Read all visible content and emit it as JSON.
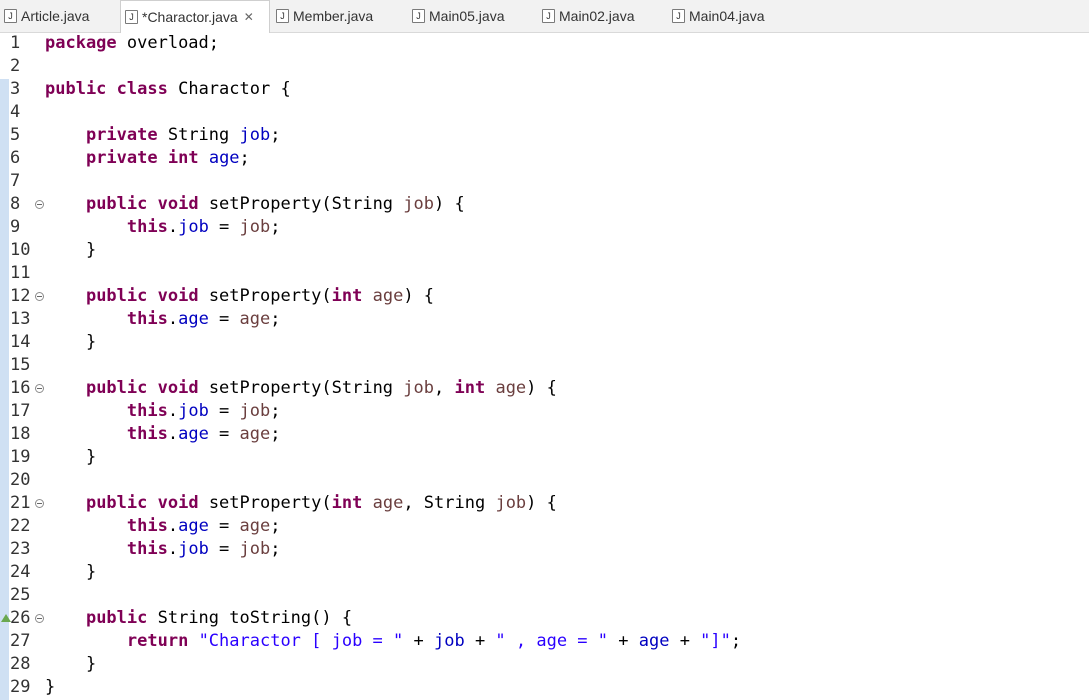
{
  "tabs": [
    {
      "label": "Article.java",
      "active": false,
      "closable": false
    },
    {
      "label": "*Charactor.java",
      "active": true,
      "closable": true
    },
    {
      "label": "Member.java",
      "active": false,
      "closable": false
    },
    {
      "label": "Main05.java",
      "active": false,
      "closable": false
    },
    {
      "label": "Main02.java",
      "active": false,
      "closable": false
    },
    {
      "label": "Main04.java",
      "active": false,
      "closable": false
    }
  ],
  "tab_icon_glyph": "J",
  "tab_close_glyph": "✕",
  "colors": {
    "keyword": "#7f0055",
    "field": "#0000c0",
    "parameter": "#6a3e3e",
    "string": "#2a00ff",
    "plain": "#000000",
    "ruler_highlight": "#cfe0f3"
  },
  "editor": {
    "lines": [
      {
        "n": "1",
        "fold": false,
        "warn": false,
        "tokens": [
          {
            "t": "kw",
            "v": "package"
          },
          {
            "t": "pl",
            "v": " overload;"
          }
        ]
      },
      {
        "n": "2",
        "fold": false,
        "warn": false,
        "tokens": []
      },
      {
        "n": "3",
        "fold": false,
        "warn": false,
        "tokens": [
          {
            "t": "kw",
            "v": "public"
          },
          {
            "t": "pl",
            "v": " "
          },
          {
            "t": "kw",
            "v": "class"
          },
          {
            "t": "pl",
            "v": " Charactor {"
          }
        ]
      },
      {
        "n": "4",
        "fold": false,
        "warn": false,
        "tokens": []
      },
      {
        "n": "5",
        "fold": false,
        "warn": false,
        "tokens": [
          {
            "t": "pl",
            "v": "    "
          },
          {
            "t": "kw",
            "v": "private"
          },
          {
            "t": "pl",
            "v": " String "
          },
          {
            "t": "fd",
            "v": "job"
          },
          {
            "t": "pl",
            "v": ";"
          }
        ]
      },
      {
        "n": "6",
        "fold": false,
        "warn": false,
        "tokens": [
          {
            "t": "pl",
            "v": "    "
          },
          {
            "t": "kw",
            "v": "private"
          },
          {
            "t": "pl",
            "v": " "
          },
          {
            "t": "kw",
            "v": "int"
          },
          {
            "t": "pl",
            "v": " "
          },
          {
            "t": "fd",
            "v": "age"
          },
          {
            "t": "pl",
            "v": ";"
          }
        ]
      },
      {
        "n": "7",
        "fold": false,
        "warn": false,
        "tokens": []
      },
      {
        "n": "8",
        "fold": true,
        "warn": false,
        "tokens": [
          {
            "t": "pl",
            "v": "    "
          },
          {
            "t": "kw",
            "v": "public"
          },
          {
            "t": "pl",
            "v": " "
          },
          {
            "t": "kw",
            "v": "void"
          },
          {
            "t": "pl",
            "v": " setProperty(String "
          },
          {
            "t": "pr",
            "v": "job"
          },
          {
            "t": "pl",
            "v": ") {"
          }
        ]
      },
      {
        "n": "9",
        "fold": false,
        "warn": false,
        "tokens": [
          {
            "t": "pl",
            "v": "        "
          },
          {
            "t": "kw",
            "v": "this"
          },
          {
            "t": "pl",
            "v": "."
          },
          {
            "t": "fd",
            "v": "job"
          },
          {
            "t": "pl",
            "v": " = "
          },
          {
            "t": "pr",
            "v": "job"
          },
          {
            "t": "pl",
            "v": ";"
          }
        ]
      },
      {
        "n": "10",
        "fold": false,
        "warn": false,
        "tokens": [
          {
            "t": "pl",
            "v": "    }"
          }
        ]
      },
      {
        "n": "11",
        "fold": false,
        "warn": false,
        "tokens": []
      },
      {
        "n": "12",
        "fold": true,
        "warn": false,
        "tokens": [
          {
            "t": "pl",
            "v": "    "
          },
          {
            "t": "kw",
            "v": "public"
          },
          {
            "t": "pl",
            "v": " "
          },
          {
            "t": "kw",
            "v": "void"
          },
          {
            "t": "pl",
            "v": " setProperty("
          },
          {
            "t": "kw",
            "v": "int"
          },
          {
            "t": "pl",
            "v": " "
          },
          {
            "t": "pr",
            "v": "age"
          },
          {
            "t": "pl",
            "v": ") {"
          }
        ]
      },
      {
        "n": "13",
        "fold": false,
        "warn": false,
        "tokens": [
          {
            "t": "pl",
            "v": "        "
          },
          {
            "t": "kw",
            "v": "this"
          },
          {
            "t": "pl",
            "v": "."
          },
          {
            "t": "fd",
            "v": "age"
          },
          {
            "t": "pl",
            "v": " = "
          },
          {
            "t": "pr",
            "v": "age"
          },
          {
            "t": "pl",
            "v": ";"
          }
        ]
      },
      {
        "n": "14",
        "fold": false,
        "warn": false,
        "tokens": [
          {
            "t": "pl",
            "v": "    }"
          }
        ]
      },
      {
        "n": "15",
        "fold": false,
        "warn": false,
        "tokens": []
      },
      {
        "n": "16",
        "fold": true,
        "warn": false,
        "tokens": [
          {
            "t": "pl",
            "v": "    "
          },
          {
            "t": "kw",
            "v": "public"
          },
          {
            "t": "pl",
            "v": " "
          },
          {
            "t": "kw",
            "v": "void"
          },
          {
            "t": "pl",
            "v": " setProperty(String "
          },
          {
            "t": "pr",
            "v": "job"
          },
          {
            "t": "pl",
            "v": ", "
          },
          {
            "t": "kw",
            "v": "int"
          },
          {
            "t": "pl",
            "v": " "
          },
          {
            "t": "pr",
            "v": "age"
          },
          {
            "t": "pl",
            "v": ") {"
          }
        ]
      },
      {
        "n": "17",
        "fold": false,
        "warn": false,
        "tokens": [
          {
            "t": "pl",
            "v": "        "
          },
          {
            "t": "kw",
            "v": "this"
          },
          {
            "t": "pl",
            "v": "."
          },
          {
            "t": "fd",
            "v": "job"
          },
          {
            "t": "pl",
            "v": " = "
          },
          {
            "t": "pr",
            "v": "job"
          },
          {
            "t": "pl",
            "v": ";"
          }
        ]
      },
      {
        "n": "18",
        "fold": false,
        "warn": false,
        "tokens": [
          {
            "t": "pl",
            "v": "        "
          },
          {
            "t": "kw",
            "v": "this"
          },
          {
            "t": "pl",
            "v": "."
          },
          {
            "t": "fd",
            "v": "age"
          },
          {
            "t": "pl",
            "v": " = "
          },
          {
            "t": "pr",
            "v": "age"
          },
          {
            "t": "pl",
            "v": ";"
          }
        ]
      },
      {
        "n": "19",
        "fold": false,
        "warn": false,
        "tokens": [
          {
            "t": "pl",
            "v": "    }"
          }
        ]
      },
      {
        "n": "20",
        "fold": false,
        "warn": false,
        "tokens": []
      },
      {
        "n": "21",
        "fold": true,
        "warn": false,
        "tokens": [
          {
            "t": "pl",
            "v": "    "
          },
          {
            "t": "kw",
            "v": "public"
          },
          {
            "t": "pl",
            "v": " "
          },
          {
            "t": "kw",
            "v": "void"
          },
          {
            "t": "pl",
            "v": " setProperty("
          },
          {
            "t": "kw",
            "v": "int"
          },
          {
            "t": "pl",
            "v": " "
          },
          {
            "t": "pr",
            "v": "age"
          },
          {
            "t": "pl",
            "v": ", String "
          },
          {
            "t": "pr",
            "v": "job"
          },
          {
            "t": "pl",
            "v": ") {"
          }
        ]
      },
      {
        "n": "22",
        "fold": false,
        "warn": false,
        "tokens": [
          {
            "t": "pl",
            "v": "        "
          },
          {
            "t": "kw",
            "v": "this"
          },
          {
            "t": "pl",
            "v": "."
          },
          {
            "t": "fd",
            "v": "age"
          },
          {
            "t": "pl",
            "v": " = "
          },
          {
            "t": "pr",
            "v": "age"
          },
          {
            "t": "pl",
            "v": ";"
          }
        ]
      },
      {
        "n": "23",
        "fold": false,
        "warn": false,
        "tokens": [
          {
            "t": "pl",
            "v": "        "
          },
          {
            "t": "kw",
            "v": "this"
          },
          {
            "t": "pl",
            "v": "."
          },
          {
            "t": "fd",
            "v": "job"
          },
          {
            "t": "pl",
            "v": " = "
          },
          {
            "t": "pr",
            "v": "job"
          },
          {
            "t": "pl",
            "v": ";"
          }
        ]
      },
      {
        "n": "24",
        "fold": false,
        "warn": false,
        "tokens": [
          {
            "t": "pl",
            "v": "    }"
          }
        ]
      },
      {
        "n": "25",
        "fold": false,
        "warn": false,
        "tokens": []
      },
      {
        "n": "26",
        "fold": true,
        "warn": true,
        "tokens": [
          {
            "t": "pl",
            "v": "    "
          },
          {
            "t": "kw",
            "v": "public"
          },
          {
            "t": "pl",
            "v": " String toString() {"
          }
        ]
      },
      {
        "n": "27",
        "fold": false,
        "warn": false,
        "tokens": [
          {
            "t": "pl",
            "v": "        "
          },
          {
            "t": "kw",
            "v": "return"
          },
          {
            "t": "pl",
            "v": " "
          },
          {
            "t": "st",
            "v": "\"Charactor [ job = \""
          },
          {
            "t": "pl",
            "v": " + "
          },
          {
            "t": "fd",
            "v": "job"
          },
          {
            "t": "pl",
            "v": " + "
          },
          {
            "t": "st",
            "v": "\" , age = \""
          },
          {
            "t": "pl",
            "v": " + "
          },
          {
            "t": "fd",
            "v": "age"
          },
          {
            "t": "pl",
            "v": " + "
          },
          {
            "t": "st",
            "v": "\"]\""
          },
          {
            "t": "pl",
            "v": ";"
          }
        ]
      },
      {
        "n": "28",
        "fold": false,
        "warn": false,
        "tokens": [
          {
            "t": "pl",
            "v": "    }"
          }
        ]
      },
      {
        "n": "29",
        "fold": false,
        "warn": false,
        "tokens": [
          {
            "t": "pl",
            "v": "}"
          }
        ]
      }
    ]
  }
}
